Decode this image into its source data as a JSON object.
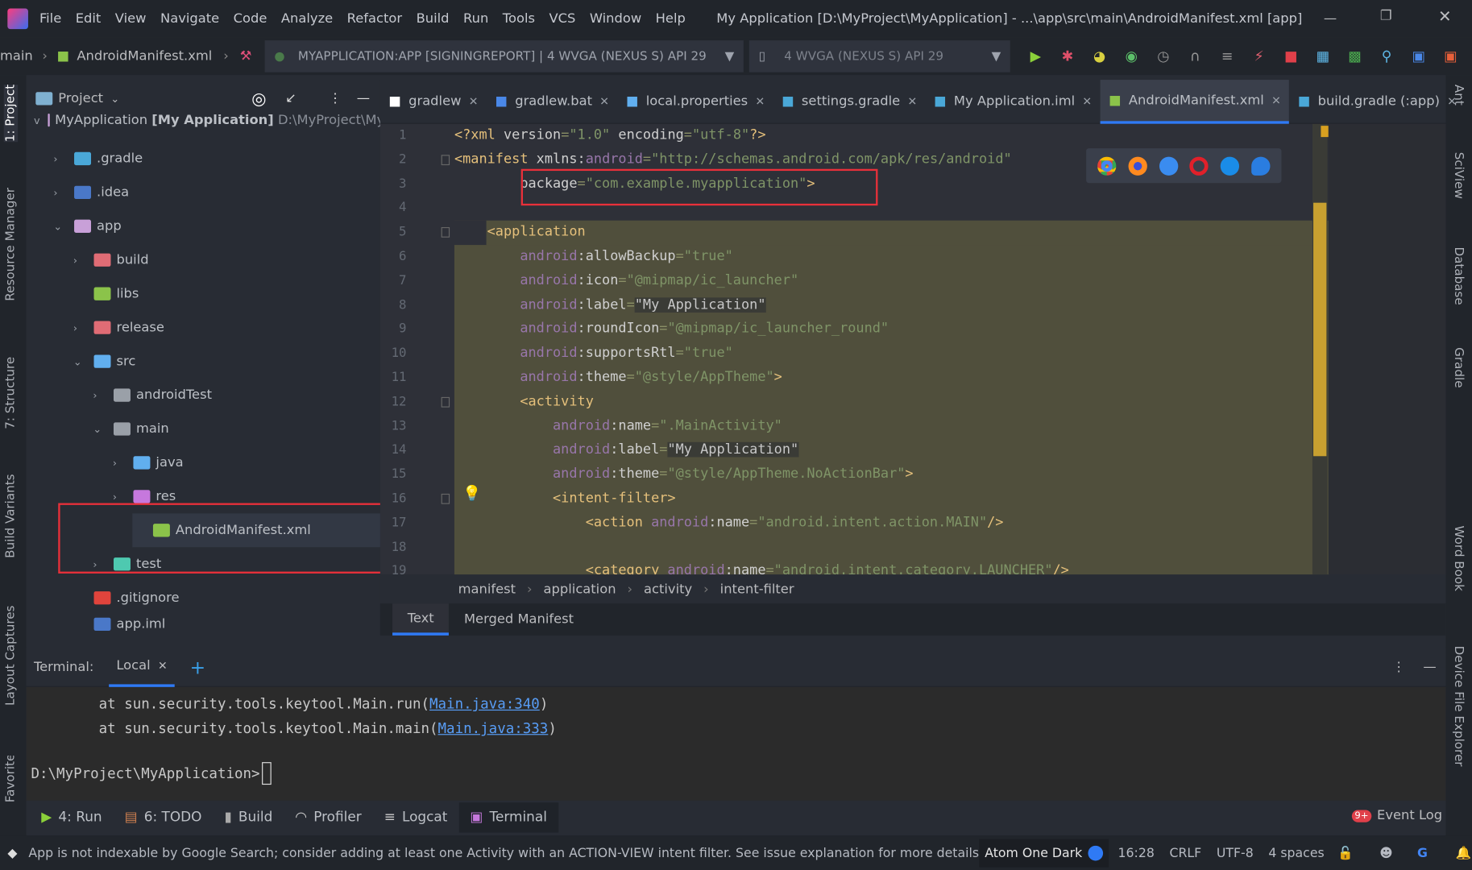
{
  "window": {
    "title": "My Application [D:\\MyProject\\MyApplication] - ...\\app\\src\\main\\AndroidManifest.xml [app]",
    "menu": [
      "File",
      "Edit",
      "View",
      "Navigate",
      "Code",
      "Analyze",
      "Refactor",
      "Build",
      "Run",
      "Tools",
      "VCS",
      "Window",
      "Help"
    ]
  },
  "toolbar": {
    "nav_main": "main",
    "nav_file": "AndroidManifest.xml",
    "run_config": "MYAPPLICATION:APP [SIGNINGREPORT] | 4  WVGA (NEXUS S) API 29",
    "device": "4  WVGA (NEXUS S) API 29"
  },
  "left_stripe": [
    "1: Project",
    "Resource Manager",
    "7: Structure",
    "Build Variants",
    "Layout Captures",
    "Favorites"
  ],
  "right_stripe": [
    "Ant",
    "SciView",
    "Database",
    "Gradle",
    "Word Book",
    "Device File Explorer"
  ],
  "project": {
    "title": "Project",
    "root": "MyApplication",
    "root_bold": "[My Application]",
    "root_path": "D:\\MyProject\\MyA",
    "tree": [
      {
        "label": ".gradle",
        "depth": 1,
        "chev": ">",
        "color": "#4aa8d8"
      },
      {
        "label": ".idea",
        "depth": 1,
        "chev": ">",
        "color": "#4a78c8"
      },
      {
        "label": "app",
        "depth": 1,
        "chev": "v",
        "color": "#c8a0d8"
      },
      {
        "label": "build",
        "depth": 2,
        "chev": ">",
        "color": "#e06c75"
      },
      {
        "label": "libs",
        "depth": 2,
        "chev": "",
        "color": "#8bc34a"
      },
      {
        "label": "release",
        "depth": 2,
        "chev": ">",
        "color": "#e06c75"
      },
      {
        "label": "src",
        "depth": 2,
        "chev": "v",
        "color": "#61afef"
      },
      {
        "label": "androidTest",
        "depth": 3,
        "chev": ">",
        "color": "#9aa0a8"
      },
      {
        "label": "main",
        "depth": 3,
        "chev": "v",
        "color": "#9aa0a8"
      },
      {
        "label": "java",
        "depth": 4,
        "chev": ">",
        "color": "#61afef"
      },
      {
        "label": "res",
        "depth": 4,
        "chev": ">",
        "color": "#c678dd"
      },
      {
        "label": "AndroidManifest.xml",
        "depth": 5,
        "chev": "",
        "color": "#8bc34a"
      },
      {
        "label": "test",
        "depth": 3,
        "chev": ">",
        "color": "#4ec9b0"
      },
      {
        "label": ".gitignore",
        "depth": 2,
        "chev": "",
        "color": "#e0443c"
      },
      {
        "label": "app.iml",
        "depth": 2,
        "chev": "",
        "color": "#4a78c8"
      }
    ]
  },
  "tabs": [
    {
      "label": "gradlew",
      "active": false
    },
    {
      "label": "gradlew.bat",
      "active": false
    },
    {
      "label": "local.properties",
      "active": false
    },
    {
      "label": "settings.gradle",
      "active": false
    },
    {
      "label": "My Application.iml",
      "active": false
    },
    {
      "label": "AndroidManifest.xml",
      "active": true
    },
    {
      "label": "build.gradle (:app)",
      "active": false
    }
  ],
  "tabs_overflow": "3",
  "editor": {
    "lines": [
      [
        [
          "<?xml ",
          "tag"
        ],
        [
          "version",
          "attr"
        ],
        [
          "=",
          "eq"
        ],
        [
          "\"1.0\"",
          "str"
        ],
        [
          " encoding",
          "attr"
        ],
        [
          "=",
          "eq"
        ],
        [
          "\"utf-8\"",
          "str"
        ],
        [
          "?>",
          "tag"
        ]
      ],
      [
        [
          "<manifest ",
          "tag"
        ],
        [
          "xmlns:",
          "attr"
        ],
        [
          "android",
          "ns"
        ],
        [
          "=",
          "eq"
        ],
        [
          "\"http://schemas.android.com/apk/res/android\"",
          "str"
        ]
      ],
      [
        [
          "        package",
          "attr"
        ],
        [
          "=",
          "eq"
        ],
        [
          "\"com.example.myapplication\"",
          "str"
        ],
        [
          ">",
          "tag"
        ]
      ],
      [],
      [
        [
          "    <application",
          "tag"
        ]
      ],
      [
        [
          "        android",
          "ns"
        ],
        [
          ":allowBackup",
          "attr"
        ],
        [
          "=",
          "eq"
        ],
        [
          "\"true\"",
          "str"
        ]
      ],
      [
        [
          "        android",
          "ns"
        ],
        [
          ":icon",
          "attr"
        ],
        [
          "=",
          "eq"
        ],
        [
          "\"@mipmap/ic_launcher\"",
          "str"
        ]
      ],
      [
        [
          "        android",
          "ns"
        ],
        [
          ":label",
          "attr"
        ],
        [
          "=",
          "eq"
        ],
        [
          "\"My Application\"",
          "plain"
        ]
      ],
      [
        [
          "        android",
          "ns"
        ],
        [
          ":roundIcon",
          "attr"
        ],
        [
          "=",
          "eq"
        ],
        [
          "\"@mipmap/ic_launcher_round\"",
          "str"
        ]
      ],
      [
        [
          "        android",
          "ns"
        ],
        [
          ":supportsRtl",
          "attr"
        ],
        [
          "=",
          "eq"
        ],
        [
          "\"true\"",
          "str"
        ]
      ],
      [
        [
          "        android",
          "ns"
        ],
        [
          ":theme",
          "attr"
        ],
        [
          "=",
          "eq"
        ],
        [
          "\"@style/AppTheme\"",
          "str"
        ],
        [
          ">",
          "tag"
        ]
      ],
      [
        [
          "        <activity",
          "tag"
        ]
      ],
      [
        [
          "            android",
          "ns"
        ],
        [
          ":name",
          "attr"
        ],
        [
          "=",
          "eq"
        ],
        [
          "\".MainActivity\"",
          "str"
        ]
      ],
      [
        [
          "            android",
          "ns"
        ],
        [
          ":label",
          "attr"
        ],
        [
          "=",
          "eq"
        ],
        [
          "\"My Application\"",
          "plain"
        ]
      ],
      [
        [
          "            android",
          "ns"
        ],
        [
          ":theme",
          "attr"
        ],
        [
          "=",
          "eq"
        ],
        [
          "\"@style/AppTheme.NoActionBar\"",
          "str"
        ],
        [
          ">",
          "tag"
        ]
      ],
      [
        [
          "            <intent-filter>",
          "tag"
        ]
      ],
      [
        [
          "                <action ",
          "tag"
        ],
        [
          "android",
          "ns"
        ],
        [
          ":name",
          "attr"
        ],
        [
          "=",
          "eq"
        ],
        [
          "\"android.intent.action.MAIN\"",
          "str"
        ],
        [
          "/>",
          "tag"
        ]
      ],
      [],
      [
        [
          "                <category ",
          "tag"
        ],
        [
          "android",
          "ns"
        ],
        [
          ":name",
          "attr"
        ],
        [
          "=",
          "eq"
        ],
        [
          "\"android.intent.category.LAUNCHER\"",
          "str"
        ],
        [
          "/>",
          "tag"
        ]
      ]
    ]
  },
  "breadcrumb": [
    "manifest",
    "application",
    "activity",
    "intent-filter"
  ],
  "editor_tabs": [
    {
      "label": "Text",
      "active": true
    },
    {
      "label": "Merged Manifest",
      "active": false
    }
  ],
  "terminal": {
    "label": "Terminal:",
    "tab": "Local",
    "lines": [
      {
        "prefix": "        at sun.security.tools.keytool.Main.run(",
        "link": "Main.java:340",
        "suffix": ")"
      },
      {
        "prefix": "        at sun.security.tools.keytool.Main.main(",
        "link": "Main.java:333",
        "suffix": ")"
      }
    ],
    "prompt": "D:\\MyProject\\MyApplication>"
  },
  "tool_tabs": [
    {
      "label": "4: Run",
      "active": false
    },
    {
      "label": "6: TODO",
      "active": false
    },
    {
      "label": "Build",
      "active": false
    },
    {
      "label": "Profiler",
      "active": false
    },
    {
      "label": "Logcat",
      "active": false
    },
    {
      "label": "Terminal",
      "active": true
    }
  ],
  "event_log": "Event Log",
  "event_badge": "9+",
  "status": {
    "message": "App is not indexable by Google Search; consider adding at least one Activity with an ACTION-VIEW intent filter. See issue explanation for more details.",
    "theme": "Atom One Dark",
    "position": "16:28",
    "line_sep": "CRLF",
    "encoding": "UTF-8",
    "indent": "4 spaces"
  },
  "colors": {
    "accent": "#2f7af5",
    "highlight_box": "#e8303a",
    "selection": "#504f3c"
  }
}
